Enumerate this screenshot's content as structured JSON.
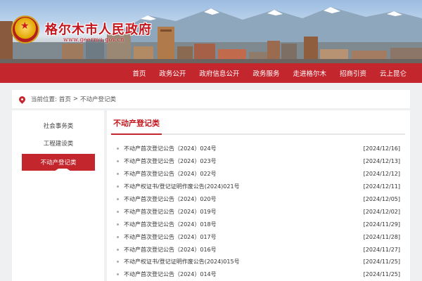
{
  "header": {
    "site_title": "格尔木市人民政府",
    "site_url": "www.geermu.gov.cn"
  },
  "nav": [
    "首页",
    "政务公开",
    "政府信息公开",
    "政务服务",
    "走进格尔木",
    "招商引资",
    "云上昆仑"
  ],
  "breadcrumb": {
    "prefix": "当前位置:",
    "home": "首页",
    "separator": ">",
    "current": "不动产登记类"
  },
  "sidebar": {
    "items": [
      "社会事务类",
      "工程建设类",
      "不动产登记类"
    ],
    "active_index": 2
  },
  "main": {
    "title": "不动产登记类",
    "items": [
      {
        "title": "不动产首次登记公告（2024）024号",
        "date": "[2024/12/16]"
      },
      {
        "title": "不动产首次登记公告（2024）023号",
        "date": "[2024/12/13]"
      },
      {
        "title": "不动产首次登记公告（2024）022号",
        "date": "[2024/12/12]"
      },
      {
        "title": "不动产权证书/登记证明作废公告(2024)021号",
        "date": "[2024/12/11]"
      },
      {
        "title": "不动产首次登记公告（2024）020号",
        "date": "[2024/12/05]"
      },
      {
        "title": "不动产首次登记公告（2024）019号",
        "date": "[2024/12/02]"
      },
      {
        "title": "不动产首次登记公告（2024）018号",
        "date": "[2024/11/29]"
      },
      {
        "title": "不动产首次登记公告（2024）017号",
        "date": "[2024/11/28]"
      },
      {
        "title": "不动产首次登记公告（2024）016号",
        "date": "[2024/11/27]"
      },
      {
        "title": "不动产权证书/登记证明作废公告(2024)015号",
        "date": "[2024/11/25]"
      },
      {
        "title": "不动产首次登记公告（2024）014号",
        "date": "[2024/11/25]"
      }
    ]
  },
  "colors": {
    "accent": "#c4262e",
    "title_red": "#c4161c",
    "background": "#eef0f2"
  }
}
